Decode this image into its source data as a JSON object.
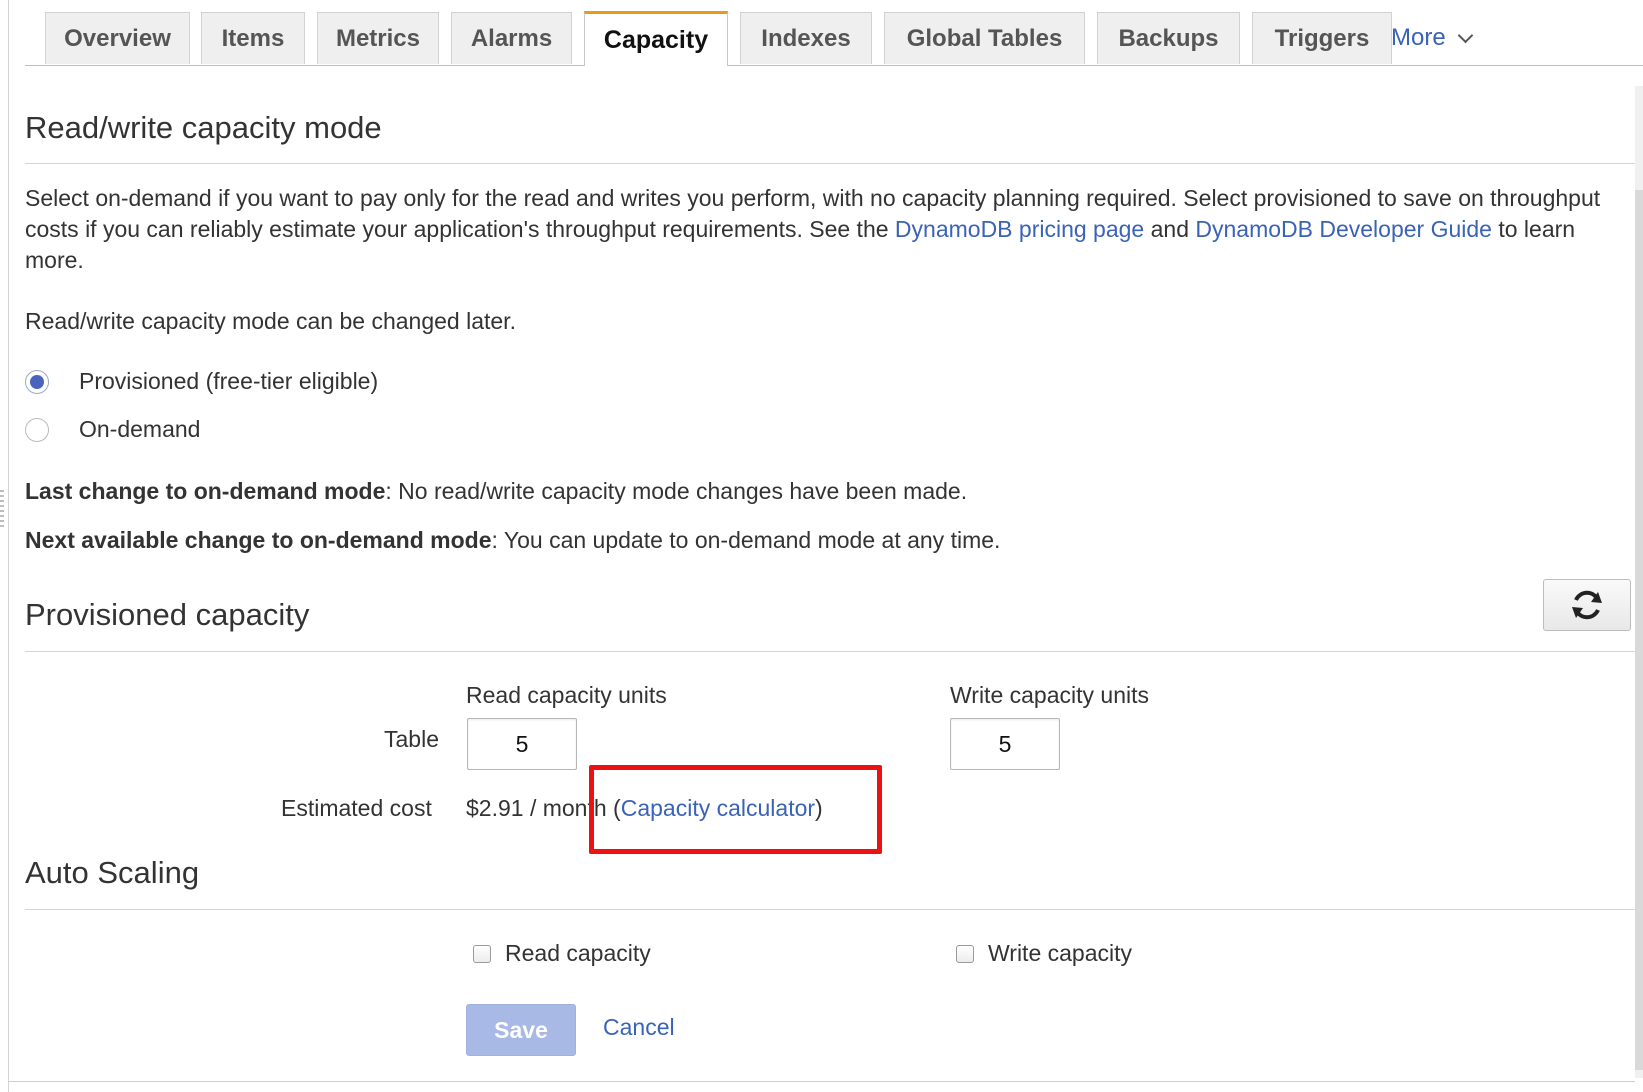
{
  "tabs": [
    {
      "label": "Overview"
    },
    {
      "label": "Items"
    },
    {
      "label": "Metrics"
    },
    {
      "label": "Alarms"
    },
    {
      "label": "Capacity",
      "active": true
    },
    {
      "label": "Indexes"
    },
    {
      "label": "Global Tables"
    },
    {
      "label": "Backups"
    },
    {
      "label": "Triggers"
    }
  ],
  "tab_more": {
    "label": "More",
    "icon": "chevron-down-icon"
  },
  "mode_section": {
    "title": "Read/write capacity mode",
    "intro_text": "Select on-demand if you want to pay only for the read and writes you perform, with no capacity planning required. Select provisioned to save on throughput costs if you can reliably estimate your application's throughput requirements. See the ",
    "pricing_link": "DynamoDB pricing page",
    "and_text": " and ",
    "guide_link": "DynamoDB Developer Guide",
    "outro_text": " to learn more.",
    "change_note": "Read/write capacity mode can be changed later.",
    "options": [
      {
        "label": "Provisioned (free-tier eligible)",
        "checked": true
      },
      {
        "label": "On-demand",
        "checked": false
      }
    ],
    "last_change_label": "Last change to on-demand mode",
    "last_change_value": ": No read/write capacity mode changes have been made.",
    "next_change_label": "Next available change to on-demand mode",
    "next_change_value": ": You can update to on-demand mode at any time."
  },
  "provisioned_section": {
    "title": "Provisioned capacity",
    "refresh_icon": "refresh-icon",
    "read_header": "Read capacity units",
    "write_header": "Write capacity units",
    "row_label": "Table",
    "read_value": "5",
    "write_value": "5",
    "cost_label": "Estimated cost",
    "cost_value": "$2.91 / month",
    "calc_open": "(",
    "calc_link": "Capacity calculator",
    "calc_close": ")",
    "highlight_color": "#ee1111"
  },
  "autoscaling_section": {
    "title": "Auto Scaling",
    "read_checkbox": "Read capacity",
    "write_checkbox": "Write capacity"
  },
  "actions": {
    "save_label": "Save",
    "cancel_label": "Cancel"
  },
  "colors": {
    "link": "#3a63b8",
    "active_tab_accent": "#e59b1b",
    "save_disabled": "#a9b9e6"
  }
}
